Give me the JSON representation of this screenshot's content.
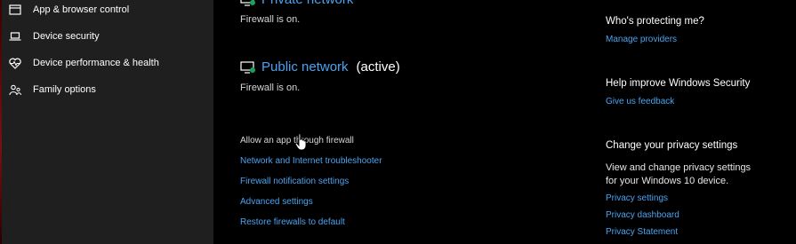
{
  "sidebar": {
    "items": [
      {
        "label": "App & browser control",
        "icon": "app-browser-window-icon"
      },
      {
        "label": "Device security",
        "icon": "laptop-icon"
      },
      {
        "label": "Device performance & health",
        "icon": "heart-icon"
      },
      {
        "label": "Family options",
        "icon": "family-people-icon"
      }
    ]
  },
  "main": {
    "private_network": {
      "title": "Private network",
      "status": "Firewall is on."
    },
    "public_network": {
      "title": "Public network",
      "active_label": "(active)",
      "status": "Firewall is on."
    },
    "allow_app_text": "Allow an app through firewall",
    "links": [
      "Network and Internet troubleshooter",
      "Firewall notification settings",
      "Advanced settings",
      "Restore firewalls to default"
    ]
  },
  "right_panel": {
    "protecting": {
      "heading": "Who's protecting me?",
      "link": "Manage providers"
    },
    "improve": {
      "heading": "Help improve Windows Security",
      "link": "Give us feedback"
    },
    "privacy": {
      "heading": "Change your privacy settings",
      "line1": "View and change privacy settings",
      "line2": "for your Windows 10 device.",
      "links": [
        "Privacy settings",
        "Privacy dashboard",
        "Privacy Statement"
      ]
    }
  },
  "colors": {
    "accent": "#4aa3f0",
    "sidebar_bg": "#1f1f1f",
    "main_bg": "#000000"
  }
}
